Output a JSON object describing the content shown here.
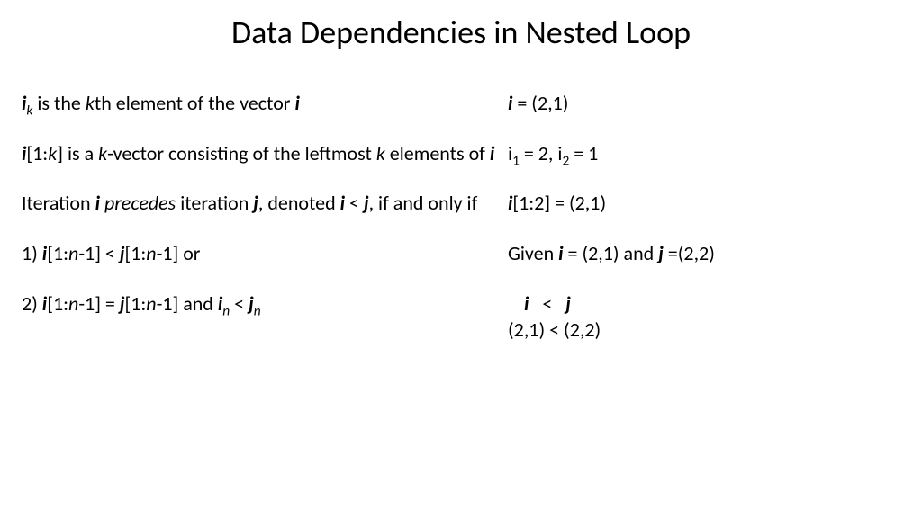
{
  "title": "Data Dependencies in Nested Loop",
  "left": {
    "p1_a": "i",
    "p1_b": "k",
    "p1_c": " is the ",
    "p1_d": "k",
    "p1_e": "th element of the vector ",
    "p1_f": "i",
    "p2_a": "i",
    "p2_b": "[1:",
    "p2_c": "k",
    "p2_d": "] is a ",
    "p2_e": "k",
    "p2_f": "-vector consisting of the leftmost ",
    "p2_g": "k",
    "p2_h": " elements of ",
    "p2_i": "i",
    "p3_a": "Iteration ",
    "p3_b": "i",
    "p3_c": " precedes",
    "p3_d": " iteration ",
    "p3_e": "j",
    "p3_f": ", denoted ",
    "p3_g": "i",
    "p3_h": " < ",
    "p3_i": "j",
    "p3_j": ", if and only if",
    "p4_a": "1) ",
    "p4_b": "i",
    "p4_c": "[1:",
    "p4_d": "n",
    "p4_e": "-1] < ",
    "p4_f": "j",
    "p4_g": "[1:",
    "p4_h": "n",
    "p4_i": "-1] or",
    "p5_a": "2) ",
    "p5_b": "i",
    "p5_c": "[1:",
    "p5_d": "n",
    "p5_e": "-1] = ",
    "p5_f": "j",
    "p5_g": "[1:",
    "p5_h": "n",
    "p5_i": "-1] and ",
    "p5_j": "i",
    "p5_k": "n",
    "p5_l": " < ",
    "p5_m": "j",
    "p5_n": "n"
  },
  "right": {
    "r1_a": "i",
    "r1_b": " = (2,1)",
    "r2_a": "i",
    "r2_b": "1",
    "r2_c": " = 2, i",
    "r2_d": "2",
    "r2_e": " = 1",
    "r3_a": "i",
    "r3_b": "[1:2] = (2,1)",
    "r4_a": "Given ",
    "r4_b": "i",
    "r4_c": " = (2,1) and ",
    "r4_d": "j",
    "r4_e": " =(2,2)",
    "r5_a": "i",
    "r5_b": "   <   ",
    "r5_c": "j",
    "r6": "(2,1) < (2,2)"
  }
}
